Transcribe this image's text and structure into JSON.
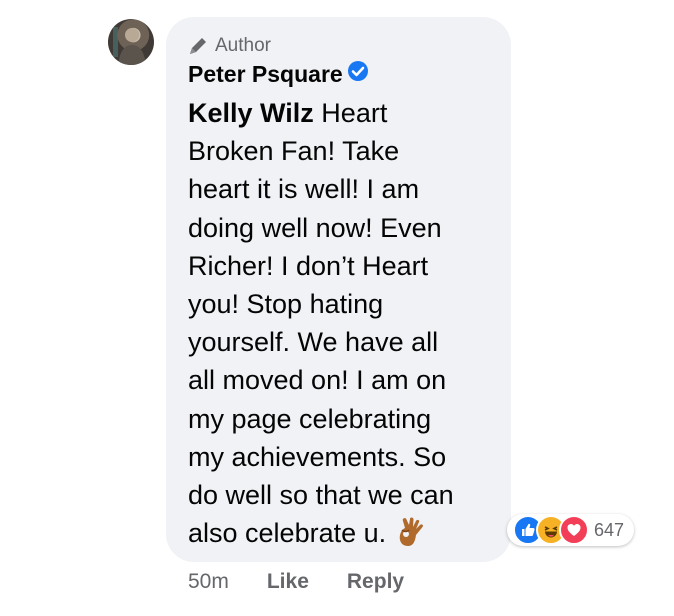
{
  "comment": {
    "author_badge": "Author",
    "author_name": "Peter Psquare",
    "mention": "Kelly Wilz",
    "message_lines": [
      " Heart",
      "Broken Fan! Take",
      "heart it is well! I am",
      "doing well now! Even",
      "Richer! I don’t Heart",
      "you! Stop hating",
      "yourself. We have all",
      "all moved on! I am on",
      "my page celebrating",
      "my achievements. So",
      "do well so that we can",
      "also celebrate u."
    ],
    "emoji_icon": "ok-hand-icon",
    "reactions": {
      "icons": [
        "like-icon",
        "haha-icon",
        "love-icon"
      ],
      "count": "647"
    },
    "actions": {
      "time": "50m",
      "like": "Like",
      "reply": "Reply"
    }
  },
  "colors": {
    "bubble": "#f0f2f5",
    "secondary_text": "#65676b",
    "like_blue": "#1877f2",
    "love_red": "#f33e58",
    "haha_yellow": "#f7b125"
  }
}
